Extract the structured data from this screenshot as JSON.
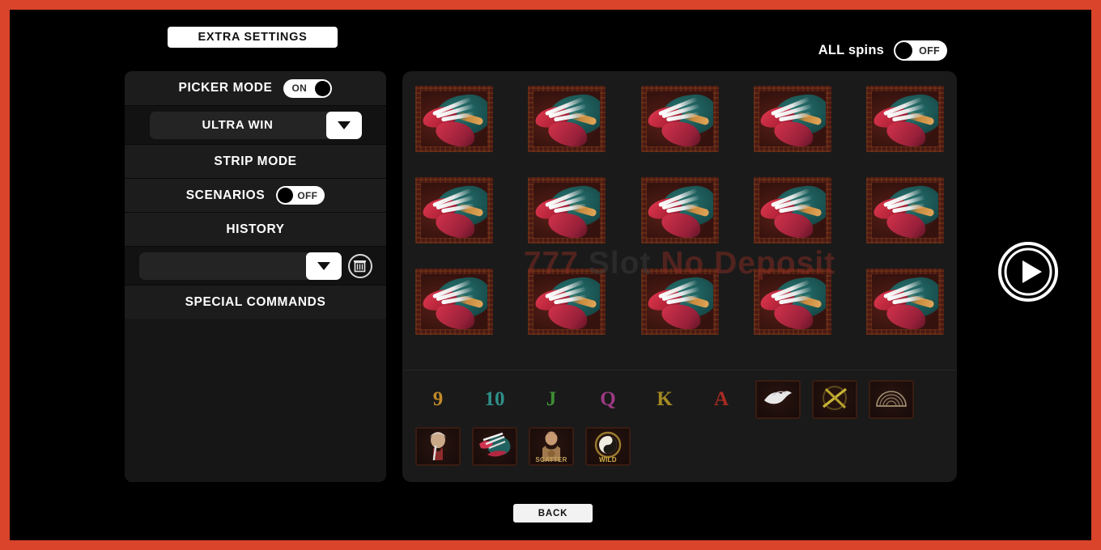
{
  "theme": {
    "frame_border_color": "#d9442a",
    "screen_bg": "#000000",
    "panel_bg": "#161616",
    "reel_panel_bg": "#1a1a1a",
    "accent_white": "#ffffff"
  },
  "topbar": {
    "extra_settings_label": "EXTRA SETTINGS",
    "all_spins_label": "ALL spins",
    "all_spins_state": "OFF"
  },
  "settings_panel": {
    "picker_mode": {
      "label": "PICKER MODE",
      "state": "ON"
    },
    "picker_select": {
      "value": "ULTRA WIN",
      "arrow_icon": "chevron-down-icon"
    },
    "strip_mode": {
      "label": "STRIP MODE"
    },
    "scenarios": {
      "label": "SCENARIOS",
      "state": "OFF"
    },
    "history": {
      "label": "HISTORY",
      "select_value": "",
      "arrow_icon": "chevron-down-icon",
      "delete_icon": "trash-icon"
    },
    "special_commands": {
      "label": "SPECIAL COMMANDS"
    }
  },
  "reels": {
    "rows": 3,
    "columns": 5,
    "symbol": "dragon-head",
    "grid": [
      [
        "dragon-head",
        "dragon-head",
        "dragon-head",
        "dragon-head",
        "dragon-head"
      ],
      [
        "dragon-head",
        "dragon-head",
        "dragon-head",
        "dragon-head",
        "dragon-head"
      ],
      [
        "dragon-head",
        "dragon-head",
        "dragon-head",
        "dragon-head",
        "dragon-head"
      ]
    ]
  },
  "watermark": {
    "part1": "777",
    "part2": "Slot",
    "part3": "No Deposit"
  },
  "palette": {
    "row1": [
      {
        "name": "symbol-9",
        "kind": "card",
        "text": "9",
        "color": "#c28a28"
      },
      {
        "name": "symbol-10",
        "kind": "card",
        "text": "10",
        "color": "#2f8f8a"
      },
      {
        "name": "symbol-j",
        "kind": "card",
        "text": "J",
        "color": "#3f8f34"
      },
      {
        "name": "symbol-q",
        "kind": "card",
        "text": "Q",
        "color": "#9c3a84"
      },
      {
        "name": "symbol-k",
        "kind": "card",
        "text": "K",
        "color": "#a58a22"
      },
      {
        "name": "symbol-a",
        "kind": "card",
        "text": "A",
        "color": "#a82a22"
      },
      {
        "name": "symbol-bird",
        "kind": "pic",
        "text": "",
        "color": "#d8d8d8"
      },
      {
        "name": "symbol-arrows",
        "kind": "pic",
        "text": "",
        "color": "#9a8a22"
      },
      {
        "name": "symbol-fan",
        "kind": "pic",
        "text": "",
        "color": "#8a7a58"
      }
    ],
    "row2": [
      {
        "name": "symbol-elder",
        "kind": "pic",
        "text": "",
        "color": "#b03a3a"
      },
      {
        "name": "symbol-dragon",
        "kind": "pic",
        "text": "",
        "color": "#2b7a77"
      },
      {
        "name": "symbol-scatter",
        "kind": "pic",
        "text": "SCATTER",
        "color": "#b08a3a"
      },
      {
        "name": "symbol-wild",
        "kind": "pic",
        "text": "WILD",
        "color": "#c8a43a"
      }
    ]
  },
  "controls": {
    "play_icon": "play-circle-icon",
    "back_label": "BACK"
  }
}
